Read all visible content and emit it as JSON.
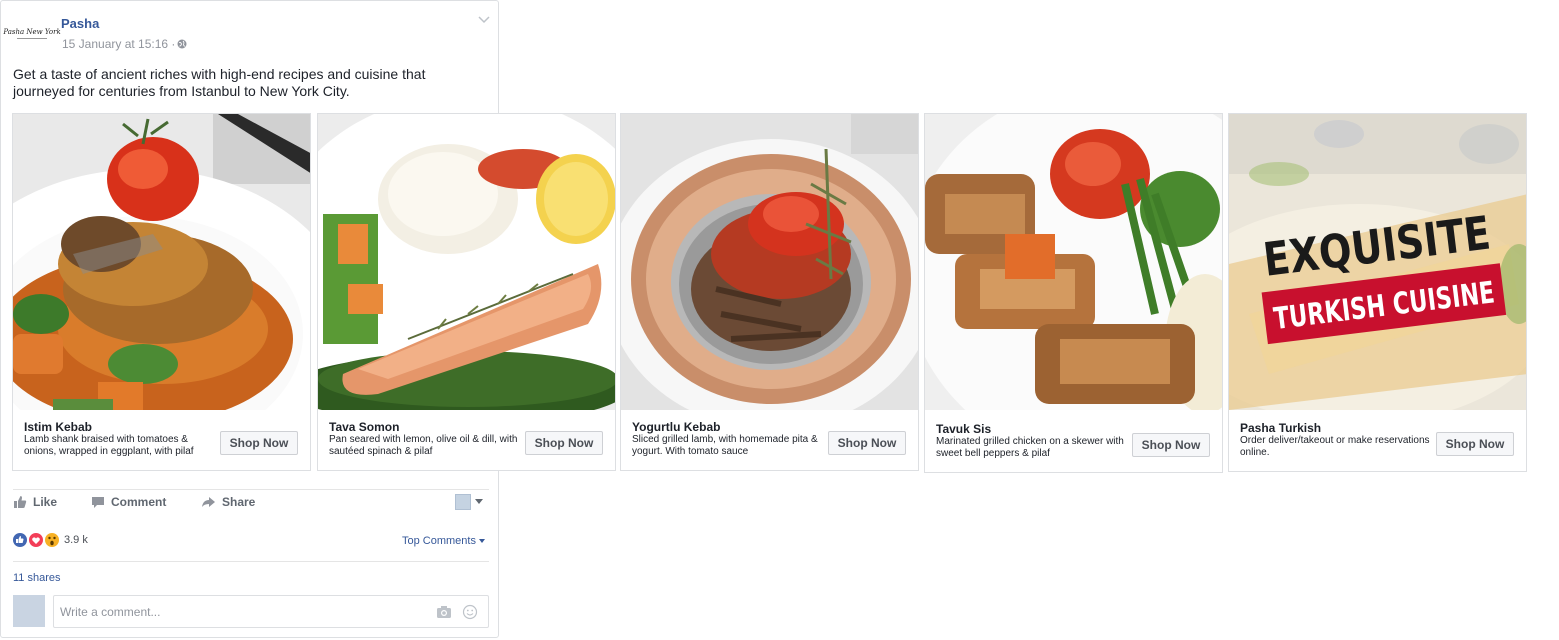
{
  "post": {
    "page_name": "Pasha",
    "logo_text": "Pasha New York",
    "timestamp": "15 January at 15:16 ·",
    "text": "Get a taste of ancient riches with high-end recipes and cuisine that journeyed for centuries from Istanbul to New York City."
  },
  "carousel": [
    {
      "title": "Istim Kebab",
      "description": "Lamb shank braised with tomatoes & onions, wrapped in eggplant, with pilaf",
      "button": "Shop Now"
    },
    {
      "title": "Tava Somon",
      "description": "Pan seared with lemon, olive oil & dill, with sautéed spinach & pilaf",
      "button": "Shop Now"
    },
    {
      "title": "Yogurtlu Kebab",
      "description": "Sliced grilled lamb, with homemade pita & yogurt. With tomato sauce",
      "button": "Shop Now"
    },
    {
      "title": "Tavuk Sis",
      "description": "Marinated grilled chicken on a skewer with sweet bell peppers & pilaf",
      "button": "Shop Now"
    },
    {
      "title": "Pasha Turkish",
      "description": "Order deliver/takeout or make reservations online.",
      "button": "Shop Now",
      "overlay_line1": "EXQUISITE",
      "overlay_line2": "TURKISH CUISINE"
    }
  ],
  "actions": {
    "like": "Like",
    "comment": "Comment",
    "share": "Share"
  },
  "engagement": {
    "reaction_count": "3.9 k",
    "top_comments": "Top Comments",
    "shares": "11 shares"
  },
  "comment_input": {
    "placeholder": "Write a comment..."
  },
  "colors": {
    "link_blue": "#365899",
    "like_blue": "#4267b2",
    "love_red": "#f33e58",
    "wow_yellow": "#f7b125",
    "banner_red": "#c8102e"
  }
}
